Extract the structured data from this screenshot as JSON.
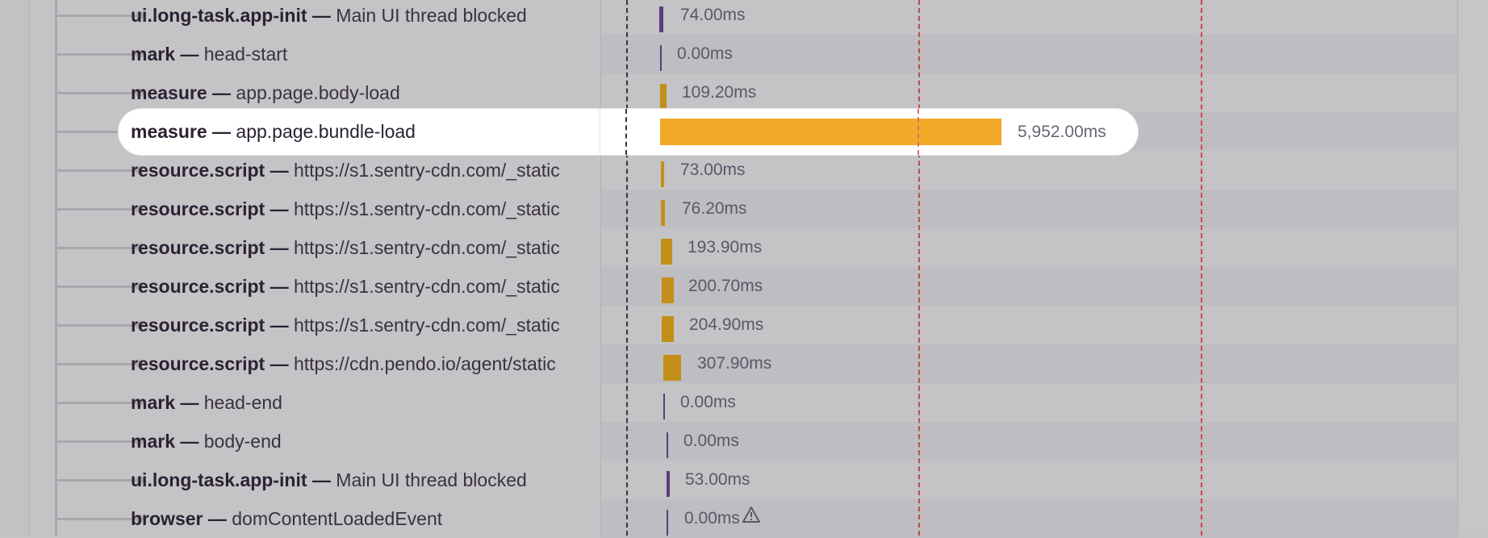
{
  "colors": {
    "measure_bar": "#f2a928",
    "resource_bar": "#c28f18",
    "task_bar": "#5b3c7a",
    "marker_red": "#c8484a",
    "marker_black": "#3b3441"
  },
  "rows": [
    {
      "op": "ui.long-task.app-init —",
      "desc": "Main UI thread blocked",
      "duration": "74.00ms",
      "kind": "task"
    },
    {
      "op": "mark —",
      "desc": "head-start",
      "duration": "0.00ms",
      "kind": "mark"
    },
    {
      "op": "measure —",
      "desc": "app.page.body-load",
      "duration": "109.20ms",
      "kind": "resource"
    },
    {
      "op": "measure —",
      "desc": "app.page.bundle-load",
      "duration": "5,952.00ms",
      "kind": "measure",
      "highlighted": true
    },
    {
      "op": "resource.script —",
      "desc": "https://s1.sentry-cdn.com/_static",
      "duration": "73.00ms",
      "kind": "resource"
    },
    {
      "op": "resource.script —",
      "desc": "https://s1.sentry-cdn.com/_static",
      "duration": "76.20ms",
      "kind": "resource"
    },
    {
      "op": "resource.script —",
      "desc": "https://s1.sentry-cdn.com/_static",
      "duration": "193.90ms",
      "kind": "resource"
    },
    {
      "op": "resource.script —",
      "desc": "https://s1.sentry-cdn.com/_static",
      "duration": "200.70ms",
      "kind": "resource"
    },
    {
      "op": "resource.script —",
      "desc": "https://s1.sentry-cdn.com/_static",
      "duration": "204.90ms",
      "kind": "resource"
    },
    {
      "op": "resource.script —",
      "desc": "https://cdn.pendo.io/agent/static",
      "duration": "307.90ms",
      "kind": "resource"
    },
    {
      "op": "mark —",
      "desc": "head-end",
      "duration": "0.00ms",
      "kind": "mark"
    },
    {
      "op": "mark —",
      "desc": "body-end",
      "duration": "0.00ms",
      "kind": "mark"
    },
    {
      "op": "ui.long-task.app-init —",
      "desc": "Main UI thread blocked",
      "duration": "53.00ms",
      "kind": "task"
    },
    {
      "op": "browser —",
      "desc": "domContentLoadedEvent",
      "duration": "0.00ms",
      "kind": "mark",
      "warning_icon": "warning-triangle-icon"
    }
  ]
}
